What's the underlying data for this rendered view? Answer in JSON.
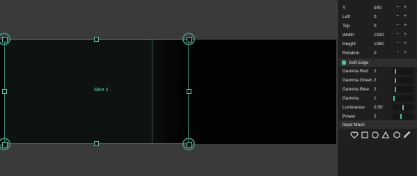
{
  "canvas": {
    "slice_label": "Slice 2"
  },
  "properties": [
    {
      "label": "Y",
      "value": "540"
    },
    {
      "label": "Left",
      "value": "0"
    },
    {
      "label": "Top",
      "value": "0"
    },
    {
      "label": "Width",
      "value": "1920"
    },
    {
      "label": "Height",
      "value": "1080"
    },
    {
      "label": "Rotation",
      "value": "0"
    }
  ],
  "stepper": {
    "minus": "−",
    "plus": "+"
  },
  "soft_edge": {
    "title": "Soft Edge",
    "sliders": [
      {
        "label": "Gamma Red",
        "value": "2",
        "level": 0.1
      },
      {
        "label": "Gamma Green",
        "value": "2",
        "level": 0.1
      },
      {
        "label": "Gamma Blue",
        "value": "2",
        "level": 0.1
      },
      {
        "label": "Gamma",
        "value": "1",
        "level": 0.05
      },
      {
        "label": "Luminance",
        "value": "0.50",
        "level": 0.5
      },
      {
        "label": "Power",
        "value": "2",
        "level": 0.4
      }
    ]
  },
  "input_mask": {
    "title": "Input Mask",
    "icons": [
      "heart-icon",
      "square-icon",
      "circle-icon",
      "triangle-icon",
      "hexagon-icon",
      "pen-icon"
    ]
  },
  "colors": {
    "accent": "#4fc1a6",
    "panel": "#1f1f1f",
    "canvas": "#3a3a3a"
  }
}
